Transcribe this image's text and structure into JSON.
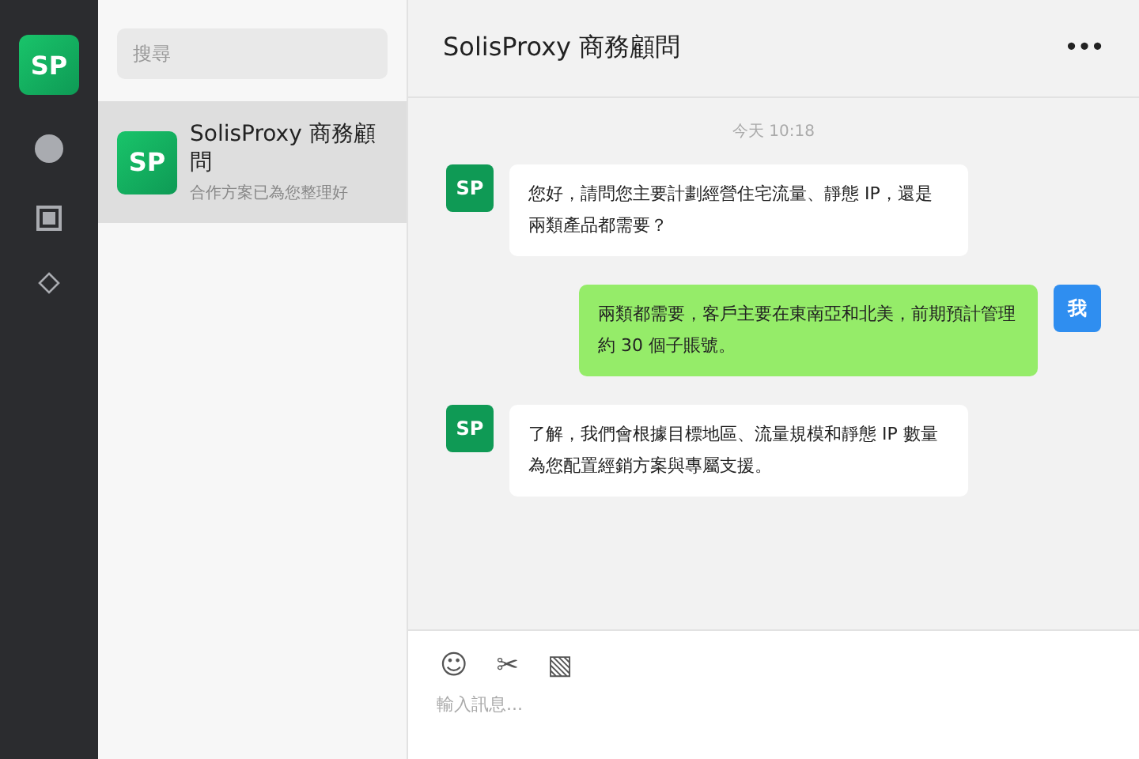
{
  "nav": {
    "logo": "SP",
    "items": [
      {
        "kind": "circle",
        "selected": false
      },
      {
        "kind": "square",
        "selected": false
      },
      {
        "kind": "diamond",
        "selected": false
      }
    ]
  },
  "search": {
    "placeholder": "搜尋"
  },
  "conversations": [
    {
      "avatar": "SP",
      "name": "SolisProxy 商務顧問",
      "preview": "合作方案已為您整理好",
      "selected": true
    }
  ],
  "chat": {
    "title": "SolisProxy 商務顧問",
    "more": "•••",
    "timestamp": "今天 10:18",
    "messages": [
      {
        "kind": "incoming",
        "avatar": "SP",
        "text": "您好，請問您主要計劃經營住宅流量、靜態 IP，還是兩類產品都需要？"
      },
      {
        "kind": "outgoing",
        "avatar": "我",
        "text": "兩類都需要，客戶主要在東南亞和北美，前期預計管理約 30 個子賬號。"
      },
      {
        "kind": "incoming",
        "avatar": "SP",
        "text": "了解，我們會根據目標地區、流量規模和靜態 IP 數量為您配置經銷方案與專屬支援。"
      }
    ]
  },
  "composer": {
    "tools": [
      "☺",
      "✂",
      "▧"
    ],
    "placeholder": "輸入訊息..."
  }
}
